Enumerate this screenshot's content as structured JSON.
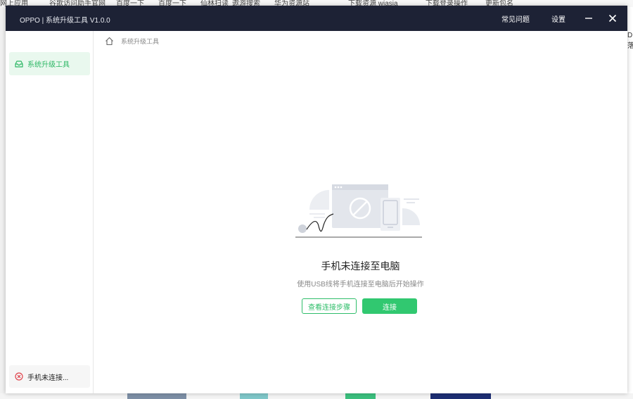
{
  "app": {
    "title": "OPPO | 系统升级工具  V1.0.0",
    "menu_faq": "常见问题",
    "menu_settings": "设置"
  },
  "sidebar": {
    "items": [
      {
        "label": "系统升级工具",
        "icon": "tray-icon"
      }
    ],
    "status": {
      "label": "手机未连接...",
      "icon": "error-circle-icon"
    }
  },
  "breadcrumb": {
    "label": "系统升级工具",
    "icon": "home-icon"
  },
  "empty_state": {
    "title": "手机未连接至电脑",
    "subtitle": "使用USB线将手机连接至电脑后开始操作",
    "steps_button": "查看连接步骤",
    "connect_button": "连接"
  },
  "colors": {
    "titlebar": "#1d2235",
    "accent": "#31c870",
    "accent_light": "#e9f8ee",
    "error": "#e0434c"
  },
  "background": {
    "bookmarks": [
      "网上应用",
      "谷歌访问助手官网",
      "百度一下",
      "百度一下",
      "仙林扫读",
      "遨游搜索",
      "华为资源站",
      "下载资源 wjasia",
      "下载登录操作",
      "更新包名"
    ],
    "right_edge_text": "D落"
  }
}
